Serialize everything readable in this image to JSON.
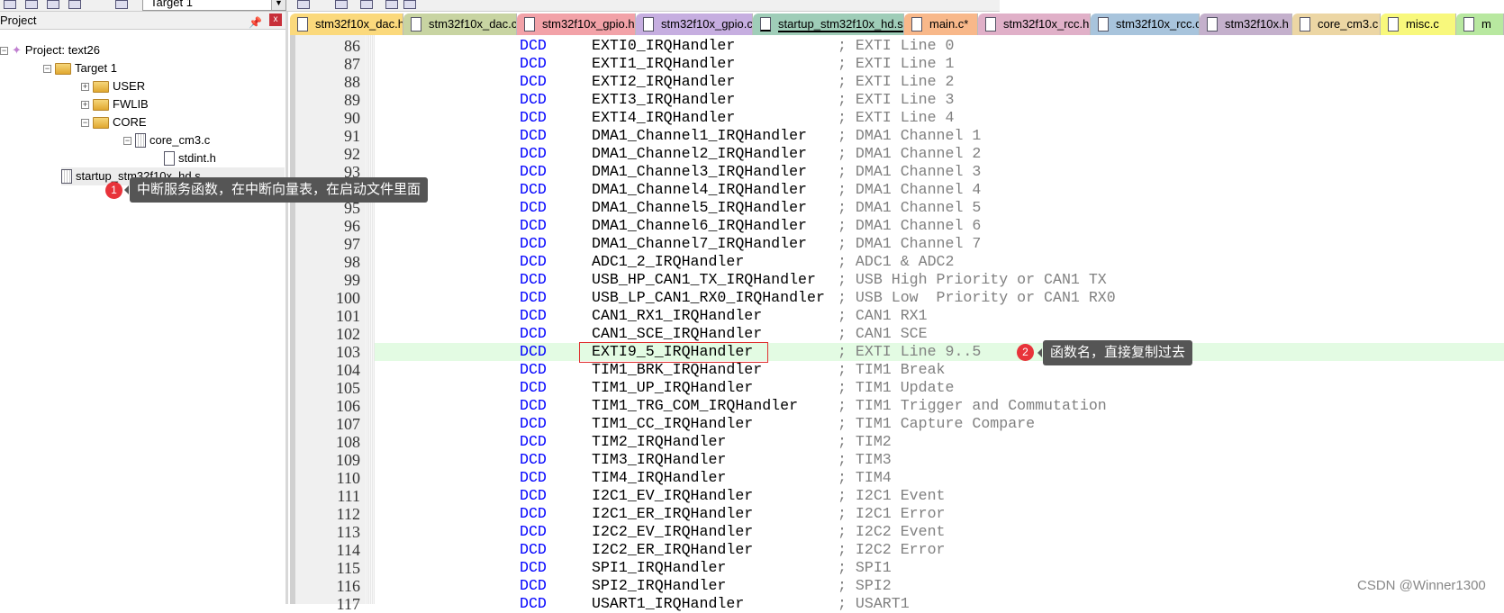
{
  "toolbar": {
    "target": "Target 1"
  },
  "project": {
    "title": "Project",
    "tree": [
      {
        "label": "Project: text26",
        "icon": "project-icon",
        "level": 0,
        "expander": "−"
      },
      {
        "label": "Target 1",
        "icon": "target-icon",
        "level": 1,
        "expander": "−"
      },
      {
        "label": "USER",
        "icon": "folder-icon",
        "level": 2,
        "expander": "+"
      },
      {
        "label": "FWLIB",
        "icon": "folder-icon",
        "level": 2,
        "expander": "+"
      },
      {
        "label": "CORE",
        "icon": "folder-open-icon",
        "level": 2,
        "expander": "−"
      },
      {
        "label": "core_cm3.c",
        "icon": "file-c-icon",
        "level": 3,
        "expander": "−"
      },
      {
        "label": "stdint.h",
        "icon": "file-h-icon",
        "level": 4,
        "expander": ""
      },
      {
        "label": "startup_stm32f10x_hd.s",
        "icon": "file-s-icon",
        "level": 3,
        "expander": ""
      }
    ]
  },
  "tabs": [
    {
      "label": "stm32f10x_dac.h",
      "color": "#fbd97c"
    },
    {
      "label": "stm32f10x_dac.c",
      "color": "#c8d4a2"
    },
    {
      "label": "stm32f10x_gpio.h",
      "color": "#f2a2a8"
    },
    {
      "label": "stm32f10x_gpio.c",
      "color": "#c6aee0"
    },
    {
      "label": "startup_stm32f10x_hd.s",
      "color": "#9fcdb8",
      "active": true
    },
    {
      "label": "main.c*",
      "color": "#f8b88a"
    },
    {
      "label": "stm32f10x_rcc.h",
      "color": "#e0b0c8"
    },
    {
      "label": "stm32f10x_rcc.c",
      "color": "#a8c4dc"
    },
    {
      "label": "stm32f10x.h",
      "color": "#c4b0cc"
    },
    {
      "label": "core_cm3.c",
      "color": "#ecd6a4"
    },
    {
      "label": "misc.c",
      "color": "#f8f87c"
    },
    {
      "label": "m",
      "color": "#b8e8a0"
    }
  ],
  "code": [
    {
      "n": "86",
      "kw": "DCD",
      "name": "EXTI0_IRQHandler",
      "comment": "; EXTI Line 0"
    },
    {
      "n": "87",
      "kw": "DCD",
      "name": "EXTI1_IRQHandler",
      "comment": "; EXTI Line 1"
    },
    {
      "n": "88",
      "kw": "DCD",
      "name": "EXTI2_IRQHandler",
      "comment": "; EXTI Line 2"
    },
    {
      "n": "89",
      "kw": "DCD",
      "name": "EXTI3_IRQHandler",
      "comment": "; EXTI Line 3"
    },
    {
      "n": "90",
      "kw": "DCD",
      "name": "EXTI4_IRQHandler",
      "comment": "; EXTI Line 4"
    },
    {
      "n": "91",
      "kw": "DCD",
      "name": "DMA1_Channel1_IRQHandler",
      "comment": "; DMA1 Channel 1"
    },
    {
      "n": "92",
      "kw": "DCD",
      "name": "DMA1_Channel2_IRQHandler",
      "comment": "; DMA1 Channel 2"
    },
    {
      "n": "93",
      "kw": "DCD",
      "name": "DMA1_Channel3_IRQHandler",
      "comment": "; DMA1 Channel 3"
    },
    {
      "n": "94",
      "kw": "DCD",
      "name": "DMA1_Channel4_IRQHandler",
      "comment": "; DMA1 Channel 4"
    },
    {
      "n": "95",
      "kw": "DCD",
      "name": "DMA1_Channel5_IRQHandler",
      "comment": "; DMA1 Channel 5"
    },
    {
      "n": "96",
      "kw": "DCD",
      "name": "DMA1_Channel6_IRQHandler",
      "comment": "; DMA1 Channel 6"
    },
    {
      "n": "97",
      "kw": "DCD",
      "name": "DMA1_Channel7_IRQHandler",
      "comment": "; DMA1 Channel 7"
    },
    {
      "n": "98",
      "kw": "DCD",
      "name": "ADC1_2_IRQHandler",
      "comment": "; ADC1 & ADC2"
    },
    {
      "n": "99",
      "kw": "DCD",
      "name": "USB_HP_CAN1_TX_IRQHandler",
      "comment": "; USB High Priority or CAN1 TX"
    },
    {
      "n": "100",
      "kw": "DCD",
      "name": "USB_LP_CAN1_RX0_IRQHandler",
      "comment": "; USB Low  Priority or CAN1 RX0"
    },
    {
      "n": "101",
      "kw": "DCD",
      "name": "CAN1_RX1_IRQHandler",
      "comment": "; CAN1 RX1"
    },
    {
      "n": "102",
      "kw": "DCD",
      "name": "CAN1_SCE_IRQHandler",
      "comment": "; CAN1 SCE"
    },
    {
      "n": "103",
      "kw": "DCD",
      "name": "EXTI9_5_IRQHandler",
      "comment": "; EXTI Line 9..5",
      "highlight": true
    },
    {
      "n": "104",
      "kw": "DCD",
      "name": "TIM1_BRK_IRQHandler",
      "comment": "; TIM1 Break"
    },
    {
      "n": "105",
      "kw": "DCD",
      "name": "TIM1_UP_IRQHandler",
      "comment": "; TIM1 Update"
    },
    {
      "n": "106",
      "kw": "DCD",
      "name": "TIM1_TRG_COM_IRQHandler",
      "comment": "; TIM1 Trigger and Commutation"
    },
    {
      "n": "107",
      "kw": "DCD",
      "name": "TIM1_CC_IRQHandler",
      "comment": "; TIM1 Capture Compare"
    },
    {
      "n": "108",
      "kw": "DCD",
      "name": "TIM2_IRQHandler",
      "comment": "; TIM2"
    },
    {
      "n": "109",
      "kw": "DCD",
      "name": "TIM3_IRQHandler",
      "comment": "; TIM3"
    },
    {
      "n": "110",
      "kw": "DCD",
      "name": "TIM4_IRQHandler",
      "comment": "; TIM4"
    },
    {
      "n": "111",
      "kw": "DCD",
      "name": "I2C1_EV_IRQHandler",
      "comment": "; I2C1 Event"
    },
    {
      "n": "112",
      "kw": "DCD",
      "name": "I2C1_ER_IRQHandler",
      "comment": "; I2C1 Error"
    },
    {
      "n": "113",
      "kw": "DCD",
      "name": "I2C2_EV_IRQHandler",
      "comment": "; I2C2 Event"
    },
    {
      "n": "114",
      "kw": "DCD",
      "name": "I2C2_ER_IRQHandler",
      "comment": "; I2C2 Error"
    },
    {
      "n": "115",
      "kw": "DCD",
      "name": "SPI1_IRQHandler",
      "comment": "; SPI1"
    },
    {
      "n": "116",
      "kw": "DCD",
      "name": "SPI2_IRQHandler",
      "comment": "; SPI2"
    },
    {
      "n": "117",
      "kw": "DCD",
      "name": "USART1_IRQHandler",
      "comment": "; USART1"
    }
  ],
  "annotations": [
    {
      "number": "1",
      "text": "中断服务函数，在中断向量表，在启动文件里面"
    },
    {
      "number": "2",
      "text": "函数名，直接复制过去"
    }
  ],
  "watermark": "CSDN @Winner1300"
}
